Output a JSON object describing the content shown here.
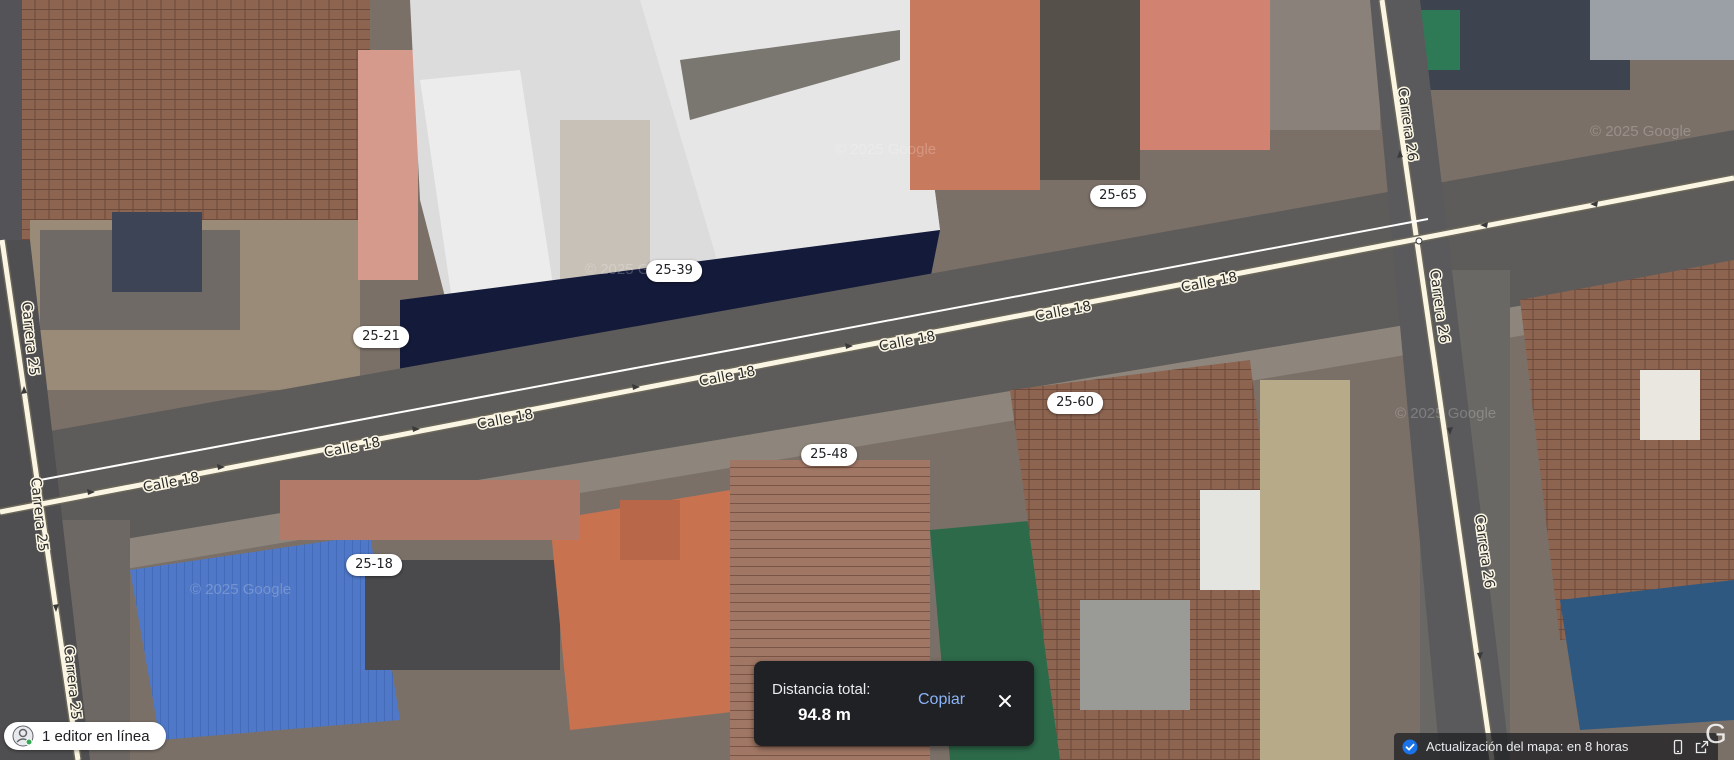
{
  "map": {
    "watermark": "© 2025 Google",
    "streets": {
      "calle": "Calle 18",
      "carrera25": "Carrera 25",
      "carrera26": "Carrera 26"
    },
    "addresses": [
      {
        "text": "25-65"
      },
      {
        "text": "25-39"
      },
      {
        "text": "25-21"
      },
      {
        "text": "25-60"
      },
      {
        "text": "25-48"
      },
      {
        "text": "25-18"
      }
    ]
  },
  "distance_panel": {
    "label": "Distancia total:",
    "value": "94.8 m",
    "copy_label": "Copiar",
    "close_icon": "close-icon"
  },
  "editor_status": {
    "text": "1 editor en línea",
    "icon": "editor-avatar-icon"
  },
  "map_update": {
    "text": "Actualización del mapa: en 8 horas",
    "icons": [
      "verified-check-icon",
      "mobile-icon",
      "open-external-icon"
    ]
  },
  "logo": "G",
  "colors": {
    "road_fill": "#fbf6e4",
    "road_outline": "#6b6759",
    "measure_line": "#ffffff",
    "panel_bg": "#202124",
    "link_blue": "#8ab4f8"
  }
}
